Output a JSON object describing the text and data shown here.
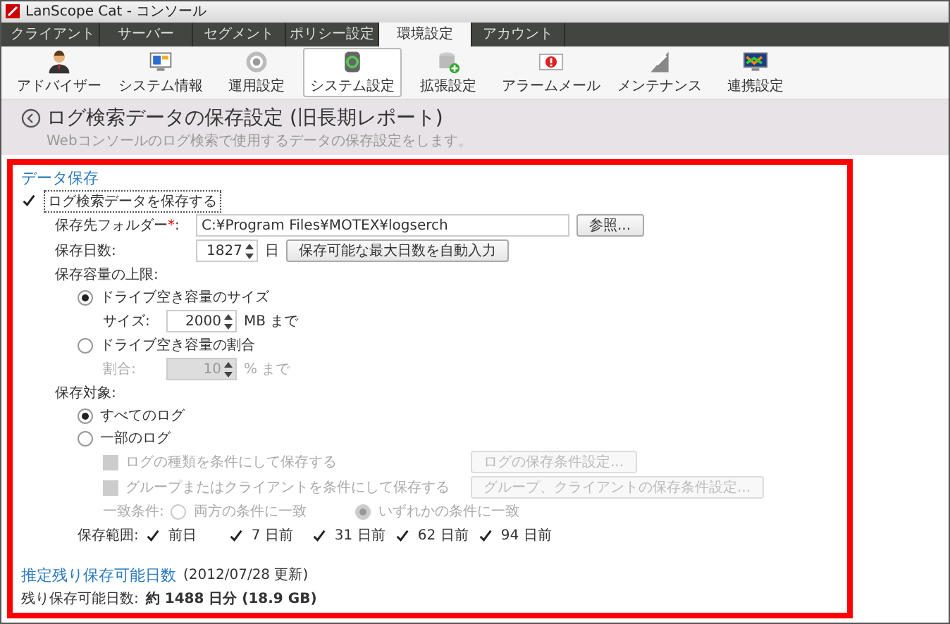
{
  "window": {
    "title": "LanScope Cat - コンソール"
  },
  "tabs": [
    {
      "label": "クライアント",
      "selected": false
    },
    {
      "label": "サーバー",
      "selected": false
    },
    {
      "label": "セグメント",
      "selected": false
    },
    {
      "label": "ポリシー設定",
      "selected": false
    },
    {
      "label": "環境設定",
      "selected": true
    },
    {
      "label": "アカウント",
      "selected": false
    }
  ],
  "toolbar": [
    {
      "label": "アドバイザー",
      "selected": false
    },
    {
      "label": "システム情報",
      "selected": false
    },
    {
      "label": "運用設定",
      "selected": false
    },
    {
      "label": "システム設定",
      "selected": true
    },
    {
      "label": "拡張設定",
      "selected": false
    },
    {
      "label": "アラームメール",
      "selected": false
    },
    {
      "label": "メンテナンス",
      "selected": false
    },
    {
      "label": "連携設定",
      "selected": false
    }
  ],
  "page": {
    "title": "ログ検索データの保存設定 (旧長期レポート)",
    "subtitle": "Webコンソールのログ検索で使用するデータの保存設定をします。"
  },
  "data_storage": {
    "heading": "データ保存",
    "save_checkbox": {
      "label": "ログ検索データを保存する",
      "checked": true
    },
    "folder": {
      "label": "保存先フォルダー",
      "required_mark": "*",
      "label_end": ":",
      "value": "C:¥Program Files¥MOTEX¥logserch",
      "browse_button": "参照..."
    },
    "days": {
      "label": "保存日数:",
      "value": "1827",
      "unit": "日",
      "auto_button": "保存可能な最大日数を自動入力"
    },
    "capacity": {
      "label": "保存容量の上限:",
      "options": [
        {
          "label": "ドライブ空き容量のサイズ",
          "selected": true,
          "field_label": "サイズ:",
          "value": "2000",
          "unit": "MB まで",
          "disabled": false
        },
        {
          "label": "ドライブ空き容量の割合",
          "selected": false,
          "field_label": "割合:",
          "value": "10",
          "unit": "% まで",
          "disabled": true
        }
      ]
    },
    "target": {
      "label": "保存対象:",
      "options": [
        {
          "label": "すべてのログ",
          "selected": true
        },
        {
          "label": "一部のログ",
          "selected": false
        }
      ],
      "conditions": [
        {
          "label": "ログの種類を条件にして保存する",
          "checked": false,
          "disabled": true,
          "button": "ログの保存条件設定..."
        },
        {
          "label": "グループまたはクライアントを条件にして保存する",
          "checked": false,
          "disabled": true,
          "button": "グループ、クライアントの保存条件設定..."
        }
      ],
      "match": {
        "label": "一致条件:",
        "disabled": true,
        "options": [
          {
            "label": "両方の条件に一致",
            "selected": false
          },
          {
            "label": "いずれかの条件に一致",
            "selected": true
          }
        ]
      }
    },
    "range": {
      "label": "保存範囲:",
      "items": [
        {
          "label": "前日",
          "checked": true
        },
        {
          "label": "7 日前",
          "checked": true
        },
        {
          "label": "31 日前",
          "checked": true
        },
        {
          "label": "62 日前",
          "checked": true
        },
        {
          "label": "94 日前",
          "checked": true
        }
      ]
    }
  },
  "estimate": {
    "heading": "推定残り保存可能日数",
    "updated": "(2012/07/28 更新)",
    "label": "残り保存可能日数:",
    "value": "約 1488 日分 (18.9 GB)"
  }
}
